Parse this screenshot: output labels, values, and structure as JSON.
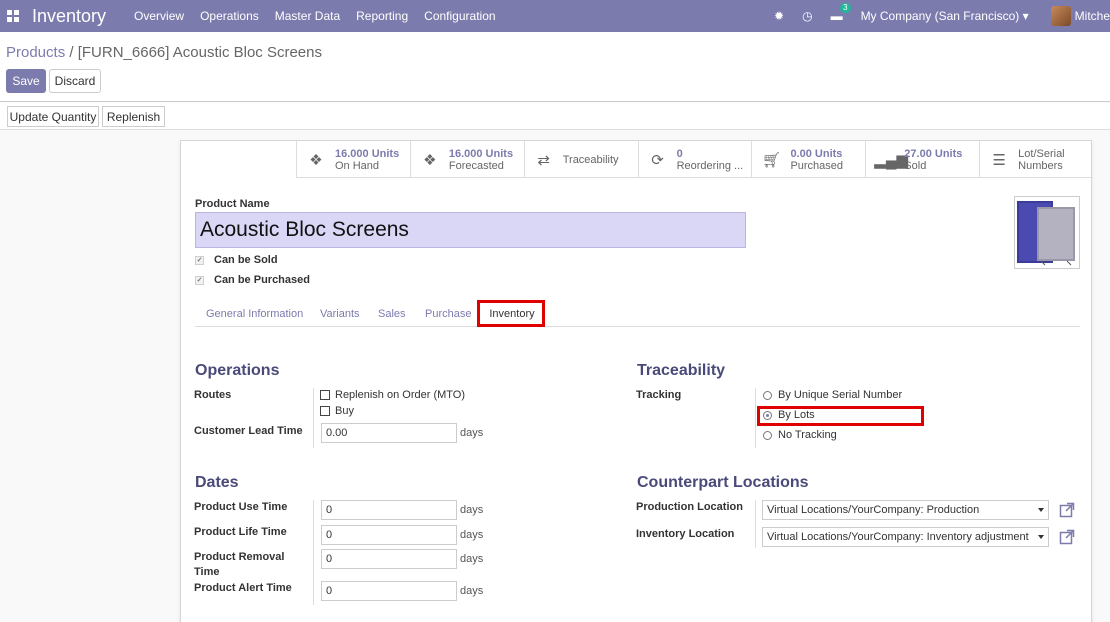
{
  "navbar": {
    "app_title": "Inventory",
    "menu": [
      "Overview",
      "Operations",
      "Master Data",
      "Reporting",
      "Configuration"
    ],
    "company": "My Company (San Francisco)",
    "user": "Mitche",
    "chat_badge": "3"
  },
  "breadcrumb": {
    "parent": "Products",
    "separator": " / ",
    "current": "[FURN_6666] Acoustic Bloc Screens"
  },
  "buttons": {
    "save": "Save",
    "discard": "Discard",
    "update_quantity": "Update Quantity",
    "replenish": "Replenish"
  },
  "smart_buttons": [
    {
      "icon": "cubes-icon",
      "value": "16.000 Units",
      "label": "On Hand"
    },
    {
      "icon": "cubes-icon",
      "value": "16.000 Units",
      "label": "Forecasted"
    },
    {
      "icon": "arrows-exchange-icon",
      "value": "",
      "label": "Traceability"
    },
    {
      "icon": "refresh-icon",
      "value": "0",
      "label": "Reordering ..."
    },
    {
      "icon": "cart-icon",
      "value": "0.00 Units",
      "label": "Purchased"
    },
    {
      "icon": "signal-bars-icon",
      "value": "27.00 Units",
      "label": "Sold"
    },
    {
      "icon": "list-icon",
      "value": "",
      "label": "Lot/Serial Numbers"
    }
  ],
  "form": {
    "product_name_label": "Product Name",
    "product_name": "Acoustic Bloc Screens",
    "can_be_sold": "Can be Sold",
    "can_be_purchased": "Can be Purchased"
  },
  "tabs": [
    "General Information",
    "Variants",
    "Sales",
    "Purchase",
    "Inventory"
  ],
  "operations": {
    "title": "Operations",
    "routes_label": "Routes",
    "routes": [
      "Replenish on Order (MTO)",
      "Buy"
    ],
    "customer_lead_time_label": "Customer Lead Time",
    "customer_lead_time": "0.00",
    "unit": "days"
  },
  "traceability": {
    "title": "Traceability",
    "tracking_label": "Tracking",
    "options": [
      "By Unique Serial Number",
      "By Lots",
      "No Tracking"
    ],
    "selected": "By Lots"
  },
  "dates": {
    "title": "Dates",
    "fields": [
      {
        "label": "Product Use Time",
        "value": "0"
      },
      {
        "label": "Product Life Time",
        "value": "0"
      },
      {
        "label": "Product Removal Time",
        "value": "0"
      },
      {
        "label": "Product Alert Time",
        "value": "0"
      }
    ],
    "unit": "days"
  },
  "counterpart": {
    "title": "Counterpart Locations",
    "production_label": "Production Location",
    "production_value": "Virtual Locations/YourCompany: Production",
    "inventory_label": "Inventory Location",
    "inventory_value": "Virtual Locations/YourCompany: Inventory adjustment"
  },
  "colors": {
    "brand": "#7c7bad",
    "highlight": "#e00000"
  }
}
